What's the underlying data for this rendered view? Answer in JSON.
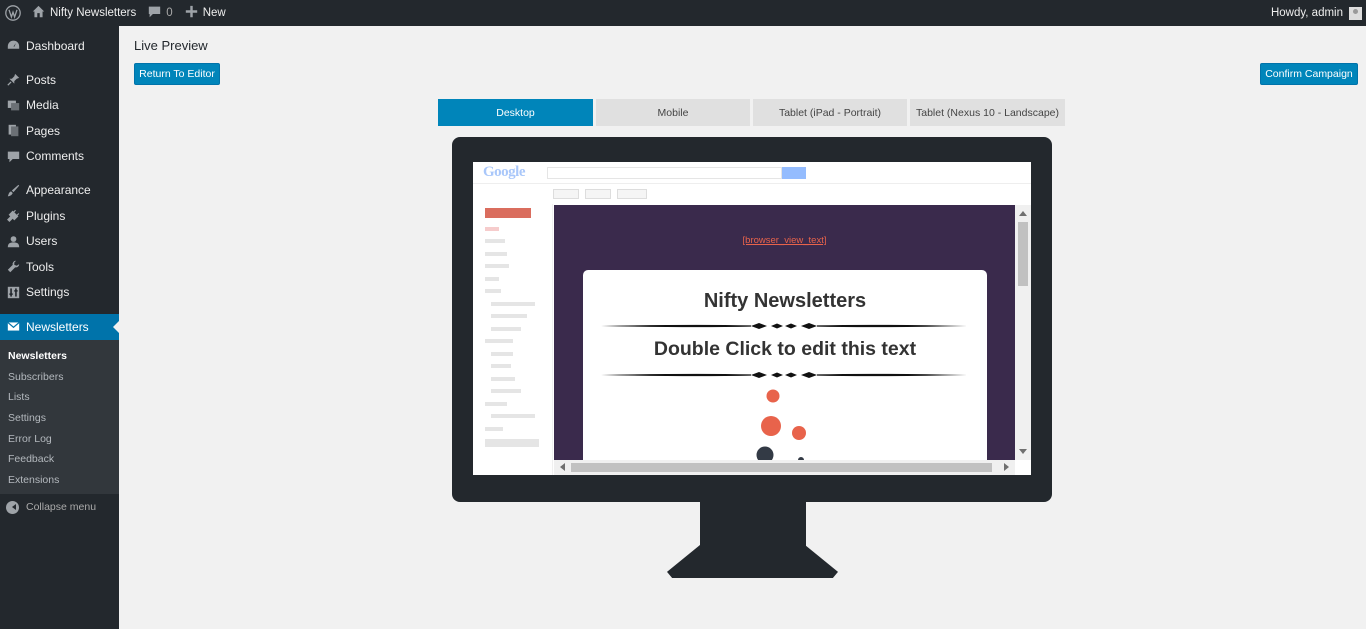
{
  "adminbar": {
    "site_name": "Nifty Newsletters",
    "comments_count": "0",
    "new_label": "New",
    "howdy": "Howdy, admin"
  },
  "sidebar": {
    "items": [
      {
        "label": "Dashboard",
        "icon": "dashboard-icon"
      },
      {
        "label": "Posts",
        "icon": "pin-icon"
      },
      {
        "label": "Media",
        "icon": "media-icon"
      },
      {
        "label": "Pages",
        "icon": "pages-icon"
      },
      {
        "label": "Comments",
        "icon": "comment-icon"
      },
      {
        "label": "Appearance",
        "icon": "brush-icon"
      },
      {
        "label": "Plugins",
        "icon": "plug-icon"
      },
      {
        "label": "Users",
        "icon": "user-icon"
      },
      {
        "label": "Tools",
        "icon": "wrench-icon"
      },
      {
        "label": "Settings",
        "icon": "settings-icon"
      },
      {
        "label": "Newsletters",
        "icon": "envelope-icon"
      }
    ],
    "submenu": [
      "Newsletters",
      "Subscribers",
      "Lists",
      "Settings",
      "Error Log",
      "Feedback",
      "Extensions"
    ],
    "collapse_label": "Collapse menu"
  },
  "main": {
    "title": "Live Preview",
    "return_button": "Return To Editor",
    "confirm_button": "Confirm Campaign",
    "tabs": [
      "Desktop",
      "Mobile",
      "Tablet (iPad - Portrait)",
      "Tablet (Nexus 10 - Landscape)"
    ],
    "active_tab": "Desktop"
  },
  "preview": {
    "gmail_logo": "Google",
    "browser_view_text": "[browser_view_text]",
    "newsletter_title": "Nifty Newsletters",
    "newsletter_subtitle": "Double Click to edit this text",
    "colors": {
      "email_background": "#3a2a4c",
      "accent_dots": "#e8634b",
      "dark_dot": "#333a45"
    }
  },
  "colors": {
    "admin_dark": "#23282d",
    "primary_blue": "#0085ba",
    "submenu_bg": "#32373c"
  }
}
